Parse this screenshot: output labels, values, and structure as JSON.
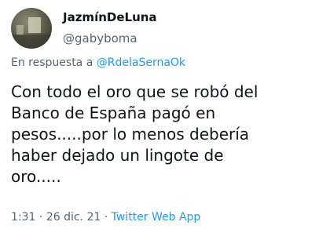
{
  "author": {
    "display_name": "JazmínDeLuna",
    "handle": "@gabyboma"
  },
  "reply": {
    "prefix": "En respuesta a",
    "mention": "@RdelaSernaOk"
  },
  "tweet": {
    "lines": [
      "Con todo el oro que se robó del",
      "Banco de España pagó en",
      "pesos.....por lo menos debería",
      "haber dejado un lingote de",
      "oro....."
    ]
  },
  "meta": {
    "time": "1:31",
    "separator1": " · ",
    "date": "26 dic. 21",
    "separator2": " · ",
    "source": "Twitter Web App"
  },
  "colors": {
    "link": "#1d9bf0",
    "secondary_text": "#536471",
    "primary_text": "#0f1419"
  }
}
